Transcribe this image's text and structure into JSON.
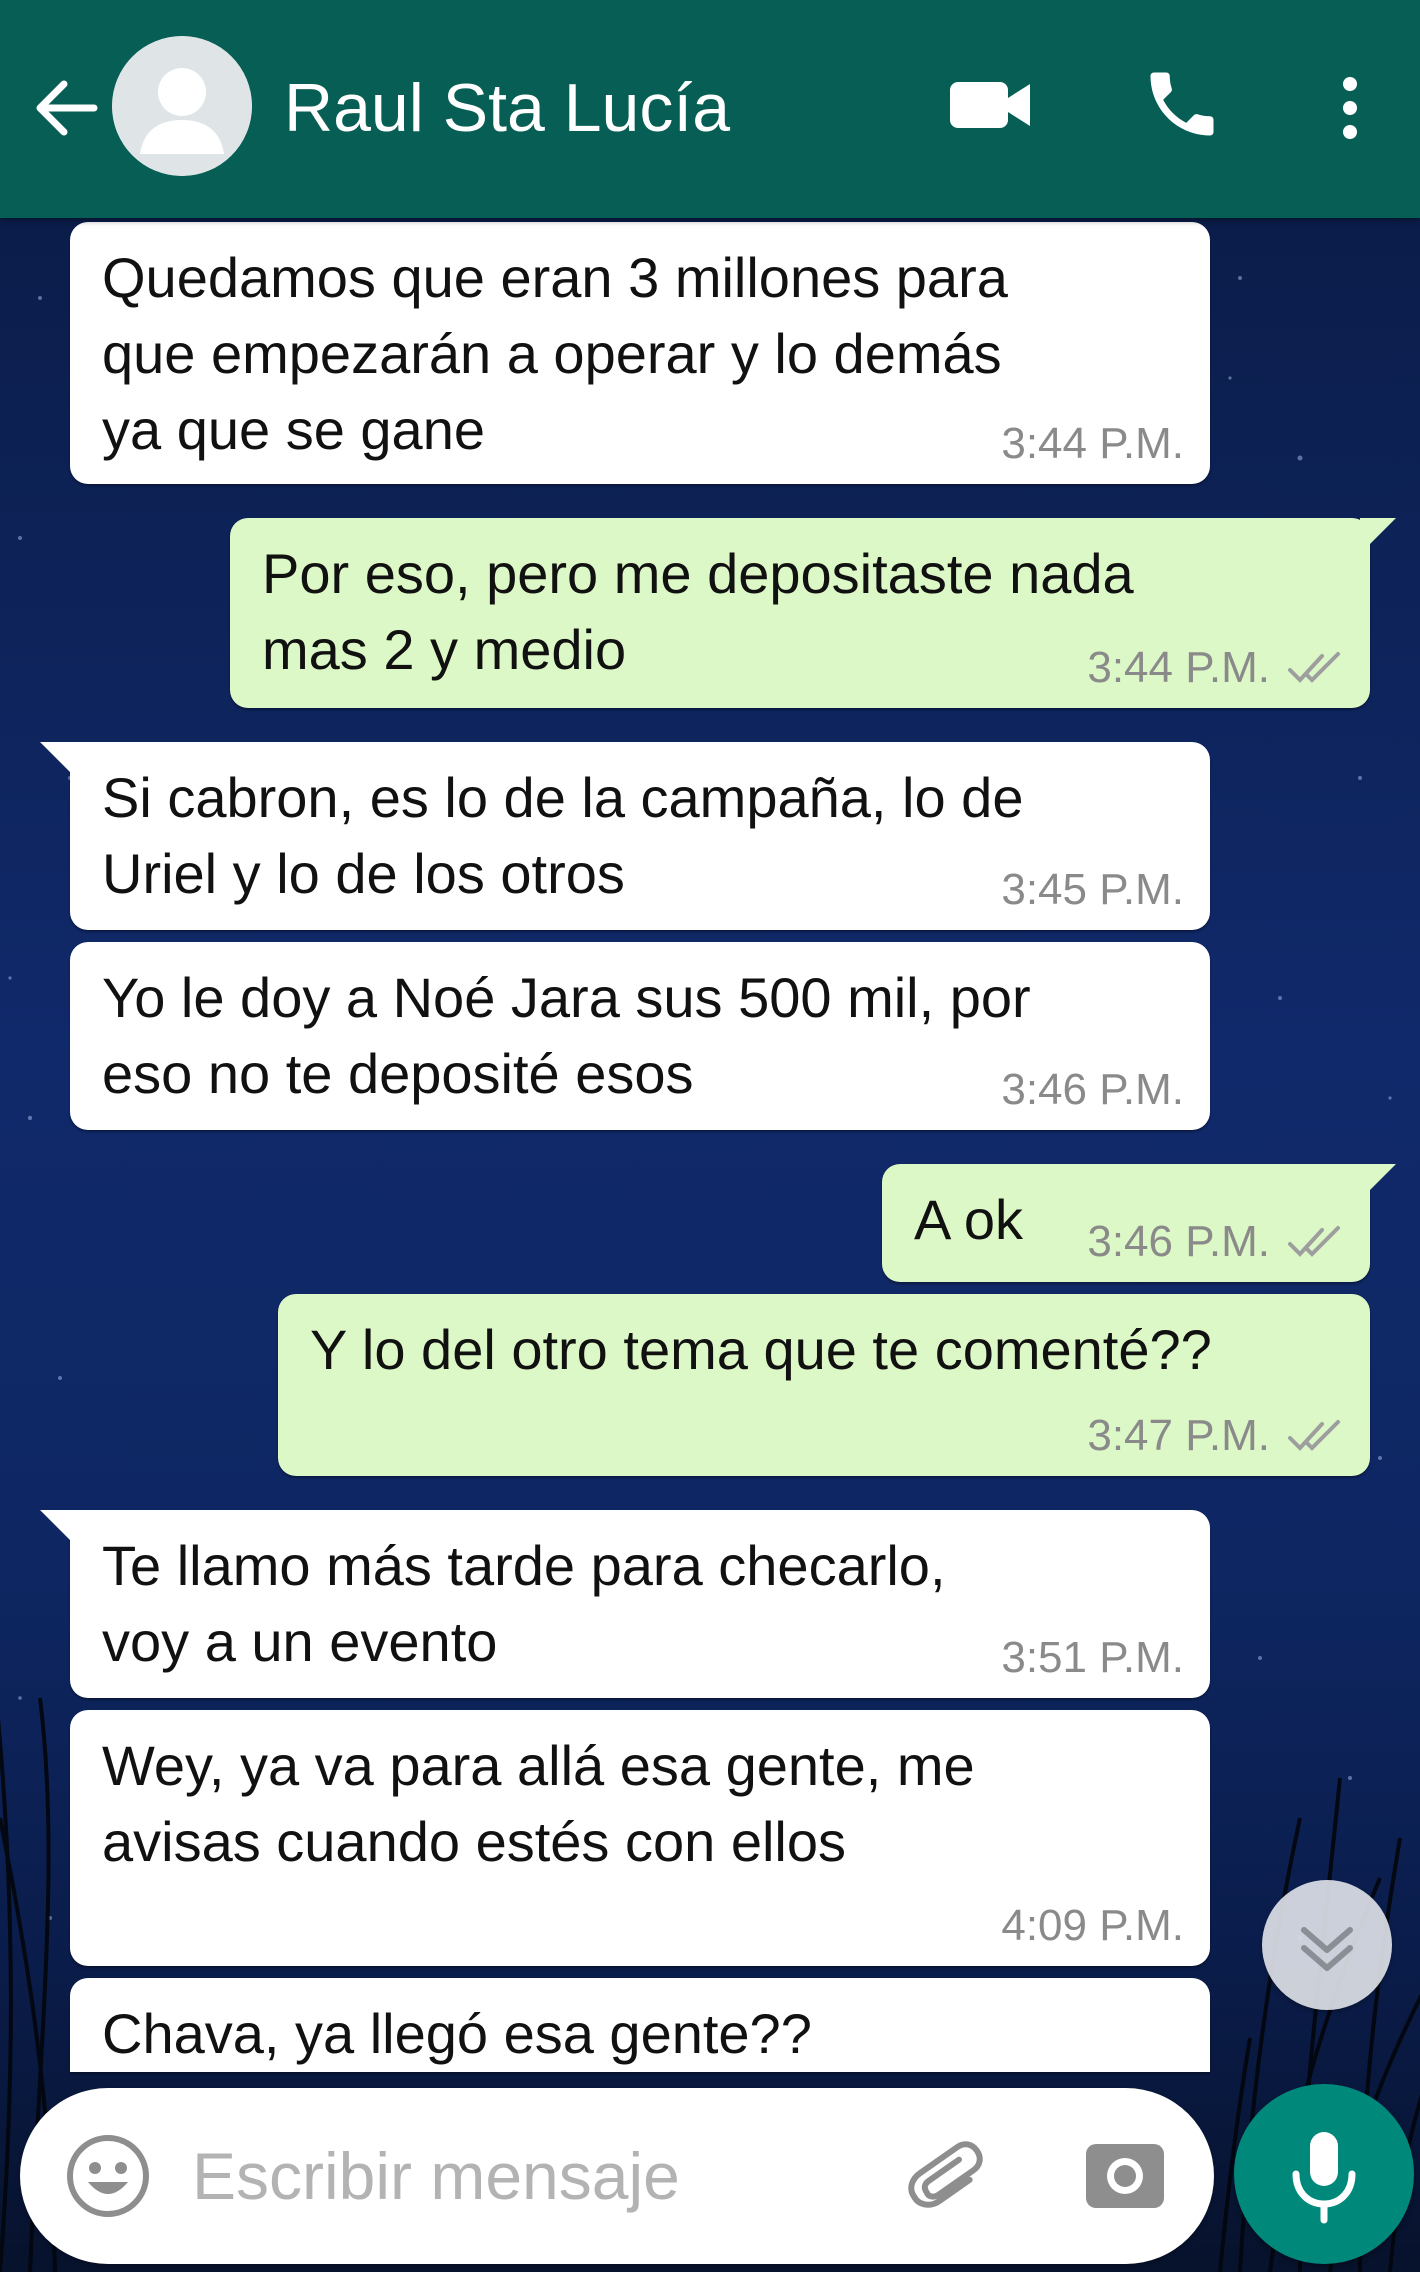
{
  "header": {
    "contact_name": "Raul Sta Lucía",
    "color": "#075e54"
  },
  "messages": [
    {
      "direction": "in",
      "text": "Quedamos que eran 3 millones para\nque empezarán a operar y lo demás\nya que se gane",
      "time": "3:44 P.M."
    },
    {
      "direction": "out",
      "text": "Por eso, pero me depositaste nada\nmas 2 y medio",
      "time": "3:44 P.M.",
      "status": "read"
    },
    {
      "direction": "in",
      "text": "Si cabron, es lo de la campaña, lo de\nUriel y lo de los otros",
      "time": "3:45 P.M."
    },
    {
      "direction": "in",
      "text": "Yo le doy a Noé Jara sus 500 mil, por\neso no te deposité esos",
      "time": "3:46 P.M."
    },
    {
      "direction": "out",
      "text": "A ok",
      "time": "3:46 P.M.",
      "status": "read"
    },
    {
      "direction": "out",
      "text": "Y lo del otro tema que te comenté??",
      "time": "3:47 P.M.",
      "status": "read"
    },
    {
      "direction": "in",
      "text": "Te llamo más tarde para checarlo,\nvoy a un evento",
      "time": "3:51 P.M."
    },
    {
      "direction": "in",
      "text": "Wey, ya va para allá esa gente, me\navisas cuando estés con ellos",
      "time": "4:09 P.M."
    },
    {
      "direction": "in",
      "text": "Chava, ya llegó esa gente??",
      "time": ""
    }
  ],
  "composer": {
    "placeholder": "Escribir mensaje",
    "value": ""
  },
  "icons": {
    "back": "arrow-left-icon",
    "avatar": "default-user-icon",
    "video": "video-camera-icon",
    "call": "phone-icon",
    "menu": "more-vert-icon",
    "emoji": "emoji-icon",
    "attach": "paperclip-icon",
    "camera": "camera-icon",
    "mic": "microphone-icon",
    "scroll": "double-chevron-down-icon"
  },
  "colors": {
    "incoming_bubble": "#ffffff",
    "outgoing_bubble": "#dcf8c6",
    "mic_button": "#00897b",
    "read_ticks": "#9e9e9e"
  }
}
